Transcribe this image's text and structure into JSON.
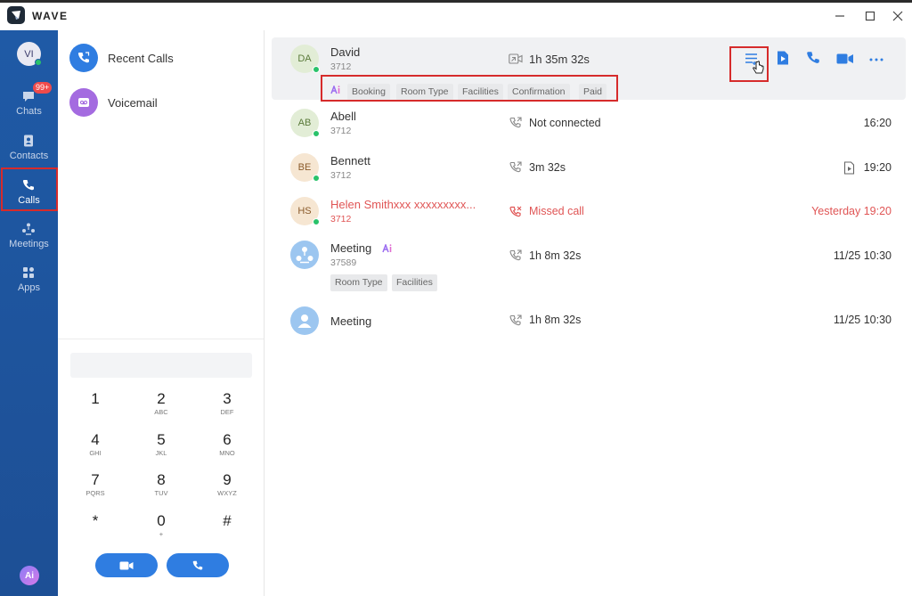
{
  "app": {
    "name": "WAVE"
  },
  "nav": {
    "avatar_initials": "VI",
    "items": [
      {
        "label": "Chats",
        "badge": "99+"
      },
      {
        "label": "Contacts"
      },
      {
        "label": "Calls"
      },
      {
        "label": "Meetings"
      },
      {
        "label": "Apps"
      }
    ],
    "ai_label": "Ai"
  },
  "sidebar": {
    "items": [
      {
        "label": "Recent Calls"
      },
      {
        "label": "Voicemail"
      }
    ]
  },
  "dialpad": {
    "input_value": "",
    "keys": [
      {
        "num": "1",
        "letters": ""
      },
      {
        "num": "2",
        "letters": "ABC"
      },
      {
        "num": "3",
        "letters": "DEF"
      },
      {
        "num": "4",
        "letters": "GHI"
      },
      {
        "num": "5",
        "letters": "JKL"
      },
      {
        "num": "6",
        "letters": "MNO"
      },
      {
        "num": "7",
        "letters": "PQRS"
      },
      {
        "num": "8",
        "letters": "TUV"
      },
      {
        "num": "9",
        "letters": "WXYZ"
      },
      {
        "num": "*",
        "letters": ""
      },
      {
        "num": "0",
        "letters": "+"
      },
      {
        "num": "#",
        "letters": ""
      }
    ]
  },
  "calls": [
    {
      "initials": "DA",
      "name": "David",
      "number": "3712",
      "type": "video",
      "status": "1h 35m 32s",
      "time": "",
      "online": true,
      "ai_tags": [
        "Booking",
        "Room Type",
        "Facilities",
        "Confirmation",
        "Paid"
      ]
    },
    {
      "initials": "AB",
      "name": "Abell",
      "number": "3712",
      "type": "outgoing",
      "status": "Not connected",
      "time": "16:20",
      "online": true
    },
    {
      "initials": "BE",
      "name": "Bennett",
      "number": "3712",
      "type": "outgoing",
      "status": "3m 32s",
      "time": "19:20",
      "online": true
    },
    {
      "initials": "HS",
      "name": "Helen Smithxxx xxxxxxxxx...",
      "number": "3712",
      "type": "missed",
      "status": "Missed call",
      "time": "Yesterday 19:20",
      "online": true
    },
    {
      "initials": "",
      "name": "Meeting",
      "number": "37589",
      "type": "outgoing",
      "status": "1h 8m 32s",
      "time": "11/25 10:30",
      "tags": [
        "Room Type",
        "Facilities"
      ]
    },
    {
      "initials": "",
      "name": "Meeting",
      "number": "",
      "type": "outgoing",
      "status": "1h 8m 32s",
      "time": "11/25 10:30"
    }
  ],
  "colors": {
    "nav_bg": "#1f5aa6",
    "accent": "#2f7de1",
    "missed": "#e05555",
    "highlight_box": "#d62b2b"
  }
}
